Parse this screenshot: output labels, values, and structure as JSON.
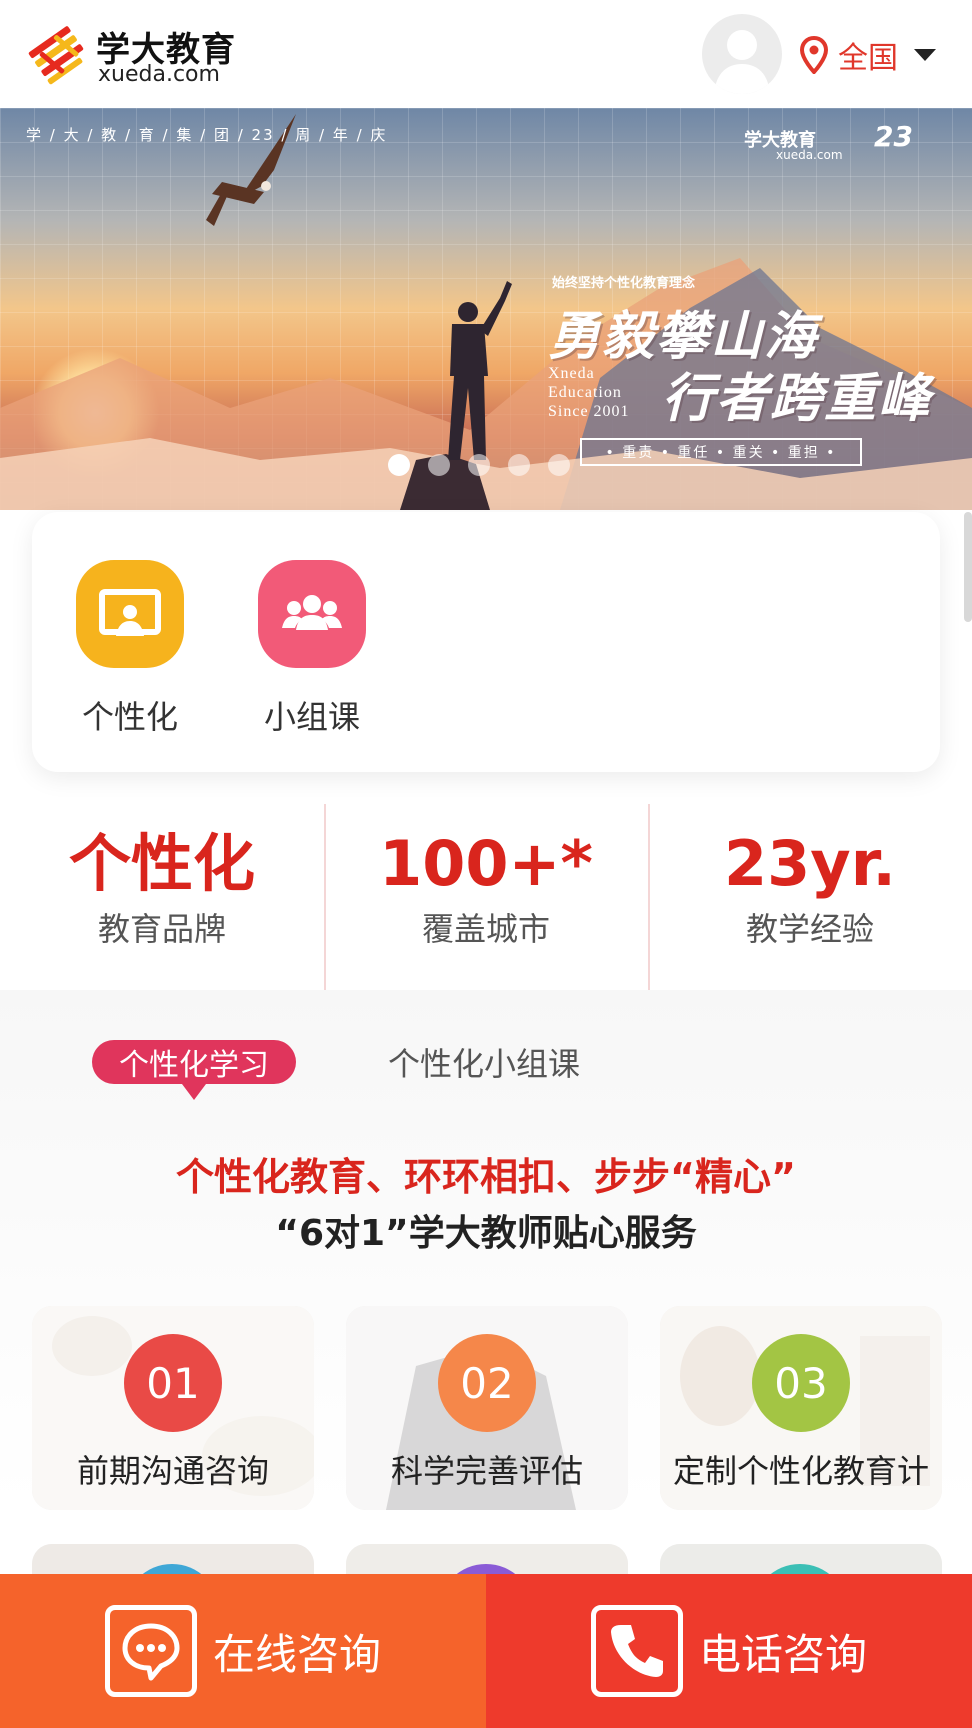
{
  "header": {
    "logo_cn": "学大教育",
    "logo_en": "xueda.com",
    "location_label": "全国",
    "colors": {
      "accent": "#e0372b"
    }
  },
  "banner": {
    "top_strip": "学 / 大 / 教 / 育 / 集 / 团 / 23 / 周 / 年 / 庆",
    "brand_cn": "学大教育",
    "brand_en": "xueda.com",
    "anniversary": "23",
    "small_caption": "始终坚持个性化教育理念",
    "headline_1": "勇毅攀山海",
    "headline_2": "行者跨重峰",
    "english_1": "Xneda",
    "english_2": "Education",
    "english_3": "Since 2001",
    "pill": "• 重责 • 重任 • 重关 • 重担 •",
    "slide_count": 5,
    "active_slide": 1
  },
  "categories": [
    {
      "label": "个性化",
      "icon": "classroom-screen-icon",
      "color": "#f6b31d"
    },
    {
      "label": "小组课",
      "icon": "group-people-icon",
      "color": "#f25a78"
    }
  ],
  "stats": [
    {
      "value": "个性化",
      "label": "教育品牌"
    },
    {
      "value": "100+*",
      "label": "覆盖城市"
    },
    {
      "value": "23yr.",
      "label": "教学经验"
    }
  ],
  "tabs": {
    "active": "个性化学习",
    "inactive": "个性化小组课"
  },
  "slogan": {
    "line1": "个性化教育、环环相扣、步步“精心”",
    "line2": "“6对1”学大教师贴心服务"
  },
  "steps": [
    {
      "num": "01",
      "label": "前期沟通咨询",
      "color": "#e94a46"
    },
    {
      "num": "02",
      "label": "科学完善评估",
      "color": "#f5874a"
    },
    {
      "num": "03",
      "label": "定制个性化教育计",
      "color": "#a3c544"
    }
  ],
  "bottom_bar": {
    "online_label": "在线咨询",
    "phone_label": "电话咨询",
    "online_color": "#f5632b",
    "phone_color": "#ee3a2c"
  }
}
